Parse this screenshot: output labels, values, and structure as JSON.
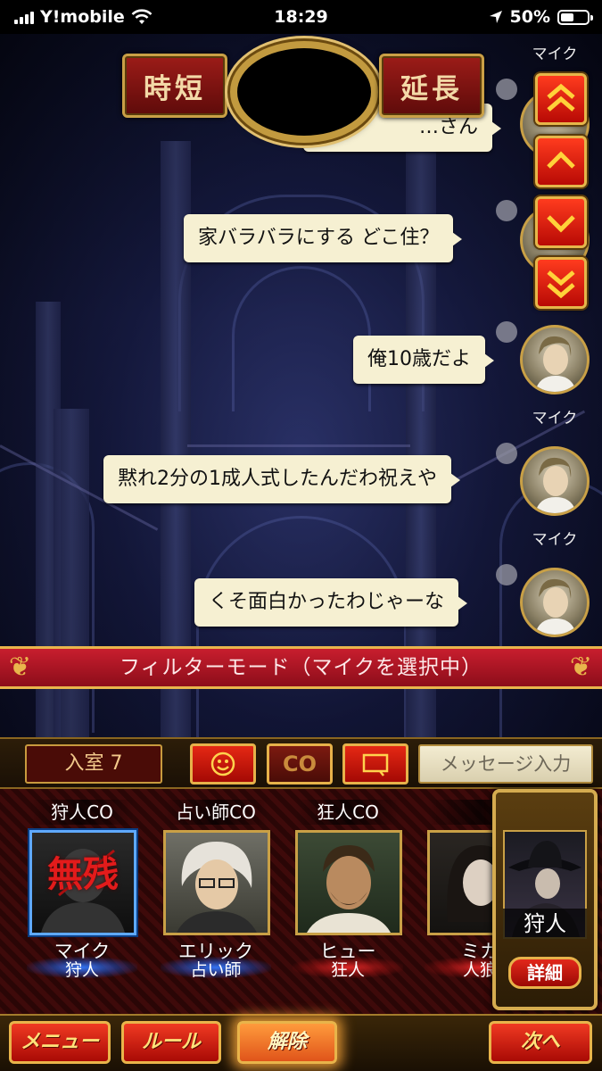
{
  "status_bar": {
    "carrier": "Y!mobile",
    "time": "18:29",
    "battery": "50%",
    "battery_level": 0.5
  },
  "header": {
    "shorten_label": "時短",
    "extend_label": "延長"
  },
  "chat": {
    "messages": [
      {
        "text": "…さん",
        "speaker": "マイク"
      },
      {
        "text": "家バラバラにする どこ住？",
        "speaker": ""
      },
      {
        "text": "俺10歳だよ",
        "speaker": "マイク"
      },
      {
        "text": "黙れ2分の1成人式したんだわ祝えや",
        "speaker": "マイク"
      },
      {
        "text": "くそ面白かったわじゃーな",
        "speaker": ""
      }
    ],
    "top_partial_name": "マイク"
  },
  "filter_banner": "フィルターモード（マイクを選択中）",
  "input_bar": {
    "room_count": "入室 7",
    "co_label": "CO",
    "message_placeholder": "メッセージ入力"
  },
  "players": [
    {
      "co": "狩人CO",
      "name": "マイク",
      "role": "狩人",
      "role_color": "#2f6fe0",
      "dead_label": "無残",
      "selected": true
    },
    {
      "co": "占い師CO",
      "name": "エリック",
      "role": "占い師",
      "role_color": "#2f6fe0"
    },
    {
      "co": "狂人CO",
      "name": "ヒュー",
      "role": "狂人",
      "role_color": "#e02a2a"
    },
    {
      "co": "",
      "name": "ミカ",
      "role": "人狼",
      "role_color": "#e02a2a"
    }
  ],
  "side_panel": {
    "role": "狩人",
    "detail_label": "詳細"
  },
  "nav": {
    "menu": "メニュー",
    "rules": "ルール",
    "third": "解除",
    "next": "次へ"
  }
}
